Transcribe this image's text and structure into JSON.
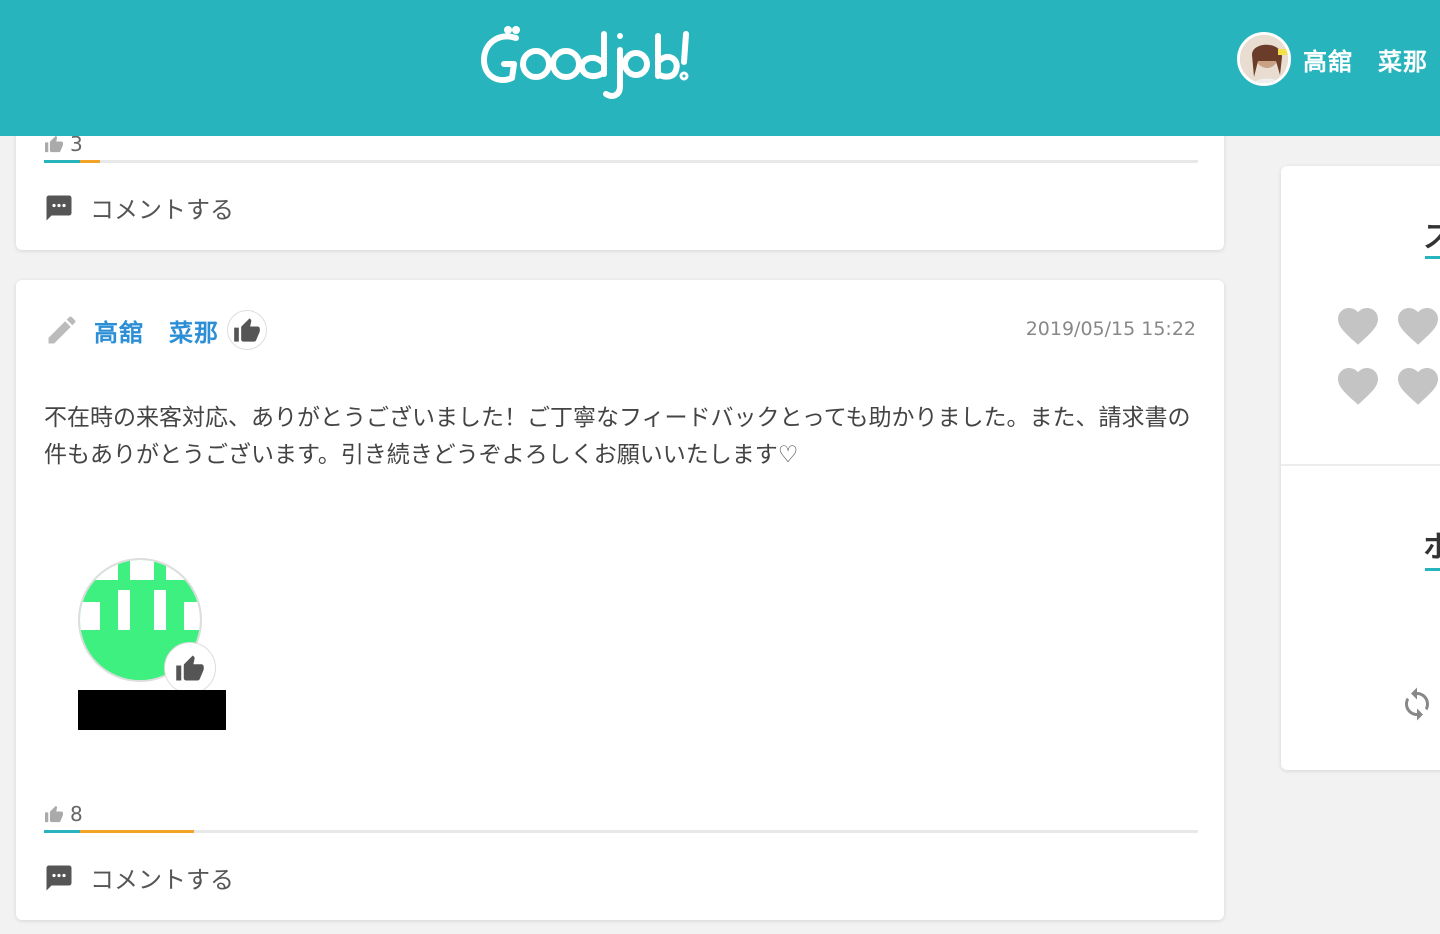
{
  "header": {
    "logo_alt": "Goodjob!",
    "user_name": "高舘　菜那"
  },
  "prev_post": {
    "like_count": "3",
    "like_ratio": 0.05,
    "comment_label": "コメントする"
  },
  "post": {
    "author": "高舘　菜那",
    "date": "2019/05/15 15:22",
    "body": "不在時の来客対応、ありがとうございました！ご丁寧なフィードバックとっても助かりました。また、請求書の件もありがとうございます。引き続きどうぞよろしくお願いいたします♡",
    "like_count": "8",
    "like_ratio": 0.13,
    "comment_label": "コメントする"
  },
  "sidebar": {
    "section1_title": "ス",
    "section2_title": "ホ"
  },
  "colors": {
    "brand": "#27b4bd",
    "accent": "#f3a325",
    "author_link": "#2c8fd6",
    "recipient_avatar": "#3ef07f"
  }
}
